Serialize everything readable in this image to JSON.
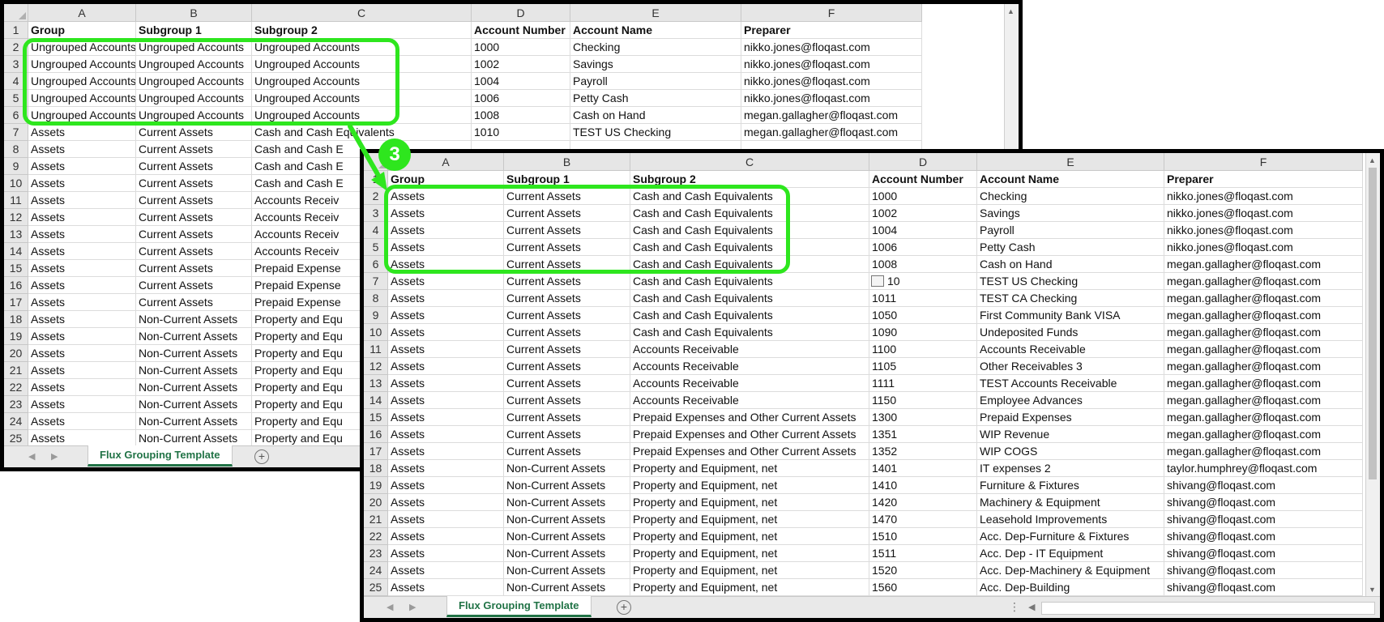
{
  "columns": [
    "A",
    "B",
    "C",
    "D",
    "E",
    "F"
  ],
  "headers": [
    "Group",
    "Subgroup 1",
    "Subgroup 2",
    "Account Number",
    "Account Name",
    "Preparer"
  ],
  "back_window": {
    "sheet_tab": "Flux Grouping Template",
    "add_sheet": "+",
    "row_numbers": [
      "1",
      "2",
      "3",
      "4",
      "5",
      "6",
      "7",
      "8",
      "9",
      "10",
      "11",
      "12",
      "13",
      "14",
      "15",
      "16",
      "17",
      "18",
      "19",
      "20",
      "21",
      "22",
      "23",
      "24",
      "25"
    ],
    "rows": [
      [
        "Ungrouped Accounts",
        "Ungrouped Accounts",
        "Ungrouped Accounts",
        "1000",
        "Checking",
        "nikko.jones@floqast.com"
      ],
      [
        "Ungrouped Accounts",
        "Ungrouped Accounts",
        "Ungrouped Accounts",
        "1002",
        "Savings",
        "nikko.jones@floqast.com"
      ],
      [
        "Ungrouped Accounts",
        "Ungrouped Accounts",
        "Ungrouped Accounts",
        "1004",
        "Payroll",
        "nikko.jones@floqast.com"
      ],
      [
        "Ungrouped Accounts",
        "Ungrouped Accounts",
        "Ungrouped Accounts",
        "1006",
        "Petty Cash",
        "nikko.jones@floqast.com"
      ],
      [
        "Ungrouped Accounts",
        "Ungrouped Accounts",
        "Ungrouped Accounts",
        "1008",
        "Cash on Hand",
        "megan.gallagher@floqast.com"
      ],
      [
        "Assets",
        "Current Assets",
        "Cash and Cash Equivalents",
        "1010",
        "TEST US Checking",
        "megan.gallagher@floqast.com"
      ],
      [
        "Assets",
        "Current Assets",
        "Cash and Cash E",
        "",
        "",
        ""
      ],
      [
        "Assets",
        "Current Assets",
        "Cash and Cash E",
        "",
        "",
        ""
      ],
      [
        "Assets",
        "Current Assets",
        "Cash and Cash E",
        "",
        "",
        ""
      ],
      [
        "Assets",
        "Current Assets",
        "Accounts Receiv",
        "",
        "",
        ""
      ],
      [
        "Assets",
        "Current Assets",
        "Accounts Receiv",
        "",
        "",
        ""
      ],
      [
        "Assets",
        "Current Assets",
        "Accounts Receiv",
        "",
        "",
        ""
      ],
      [
        "Assets",
        "Current Assets",
        "Accounts Receiv",
        "",
        "",
        ""
      ],
      [
        "Assets",
        "Current Assets",
        "Prepaid Expense",
        "",
        "",
        ""
      ],
      [
        "Assets",
        "Current Assets",
        "Prepaid Expense",
        "",
        "",
        ""
      ],
      [
        "Assets",
        "Current Assets",
        "Prepaid Expense",
        "",
        "",
        ""
      ],
      [
        "Assets",
        "Non-Current Assets",
        "Property and Equ",
        "",
        "",
        ""
      ],
      [
        "Assets",
        "Non-Current Assets",
        "Property and Equ",
        "",
        "",
        ""
      ],
      [
        "Assets",
        "Non-Current Assets",
        "Property and Equ",
        "",
        "",
        ""
      ],
      [
        "Assets",
        "Non-Current Assets",
        "Property and Equ",
        "",
        "",
        ""
      ],
      [
        "Assets",
        "Non-Current Assets",
        "Property and Equ",
        "",
        "",
        ""
      ],
      [
        "Assets",
        "Non-Current Assets",
        "Property and Equ",
        "",
        "",
        ""
      ],
      [
        "Assets",
        "Non-Current Assets",
        "Property and Equ",
        "",
        "",
        ""
      ],
      [
        "Assets",
        "Non-Current Assets",
        "Property and Equ",
        "",
        "",
        ""
      ]
    ]
  },
  "front_window": {
    "sheet_tab": "Flux Grouping Template",
    "add_sheet": "+",
    "row_numbers": [
      "1",
      "2",
      "3",
      "4",
      "5",
      "6",
      "7",
      "8",
      "9",
      "10",
      "11",
      "12",
      "13",
      "14",
      "15",
      "16",
      "17",
      "18",
      "19",
      "20",
      "21",
      "22",
      "23",
      "24",
      "25"
    ],
    "row7_account_partial": "10",
    "rows": [
      [
        "Assets",
        "Current Assets",
        "Cash and Cash Equivalents",
        "1000",
        "Checking",
        "nikko.jones@floqast.com"
      ],
      [
        "Assets",
        "Current Assets",
        "Cash and Cash Equivalents",
        "1002",
        "Savings",
        "nikko.jones@floqast.com"
      ],
      [
        "Assets",
        "Current Assets",
        "Cash and Cash Equivalents",
        "1004",
        "Payroll",
        "nikko.jones@floqast.com"
      ],
      [
        "Assets",
        "Current Assets",
        "Cash and Cash Equivalents",
        "1006",
        "Petty Cash",
        "nikko.jones@floqast.com"
      ],
      [
        "Assets",
        "Current Assets",
        "Cash and Cash Equivalents",
        "1008",
        "Cash on Hand",
        "megan.gallagher@floqast.com"
      ],
      [
        "Assets",
        "Current Assets",
        "Cash and Cash Equivalents",
        "",
        "TEST US Checking",
        "megan.gallagher@floqast.com"
      ],
      [
        "Assets",
        "Current Assets",
        "Cash and Cash Equivalents",
        "1011",
        "TEST CA Checking",
        "megan.gallagher@floqast.com"
      ],
      [
        "Assets",
        "Current Assets",
        "Cash and Cash Equivalents",
        "1050",
        "First Community Bank VISA",
        "megan.gallagher@floqast.com"
      ],
      [
        "Assets",
        "Current Assets",
        "Cash and Cash Equivalents",
        "1090",
        "Undeposited Funds",
        "megan.gallagher@floqast.com"
      ],
      [
        "Assets",
        "Current Assets",
        "Accounts Receivable",
        "1100",
        "Accounts Receivable",
        "megan.gallagher@floqast.com"
      ],
      [
        "Assets",
        "Current Assets",
        "Accounts Receivable",
        "1105",
        "Other Receivables 3",
        "megan.gallagher@floqast.com"
      ],
      [
        "Assets",
        "Current Assets",
        "Accounts Receivable",
        "1111",
        "TEST Accounts Receivable",
        "megan.gallagher@floqast.com"
      ],
      [
        "Assets",
        "Current Assets",
        "Accounts Receivable",
        "1150",
        "Employee Advances",
        "megan.gallagher@floqast.com"
      ],
      [
        "Assets",
        "Current Assets",
        "Prepaid Expenses and Other Current Assets",
        "1300",
        "Prepaid Expenses",
        "megan.gallagher@floqast.com"
      ],
      [
        "Assets",
        "Current Assets",
        "Prepaid Expenses and Other Current Assets",
        "1351",
        "WIP Revenue",
        "megan.gallagher@floqast.com"
      ],
      [
        "Assets",
        "Current Assets",
        "Prepaid Expenses and Other Current Assets",
        "1352",
        "WIP COGS",
        "megan.gallagher@floqast.com"
      ],
      [
        "Assets",
        "Non-Current Assets",
        "Property and Equipment, net",
        "1401",
        "IT expenses 2",
        "taylor.humphrey@floqast.com"
      ],
      [
        "Assets",
        "Non-Current Assets",
        "Property and Equipment, net",
        "1410",
        "Furniture & Fixtures",
        "shivang@floqast.com"
      ],
      [
        "Assets",
        "Non-Current Assets",
        "Property and Equipment, net",
        "1420",
        "Machinery & Equipment",
        "shivang@floqast.com"
      ],
      [
        "Assets",
        "Non-Current Assets",
        "Property and Equipment, net",
        "1470",
        "Leasehold Improvements",
        "shivang@floqast.com"
      ],
      [
        "Assets",
        "Non-Current Assets",
        "Property and Equipment, net",
        "1510",
        "Acc. Dep-Furniture & Fixtures",
        "shivang@floqast.com"
      ],
      [
        "Assets",
        "Non-Current Assets",
        "Property and Equipment, net",
        "1511",
        "Acc. Dep - IT Equipment",
        "shivang@floqast.com"
      ],
      [
        "Assets",
        "Non-Current Assets",
        "Property and Equipment, net",
        "1520",
        "Acc. Dep-Machinery & Equipment",
        "shivang@floqast.com"
      ],
      [
        "Assets",
        "Non-Current Assets",
        "Property and Equipment, net",
        "1560",
        "Acc. Dep-Building",
        "shivang@floqast.com"
      ]
    ]
  },
  "step_badge": "3",
  "colors": {
    "highlight": "#2ee61e",
    "tab_accent": "#217346"
  }
}
